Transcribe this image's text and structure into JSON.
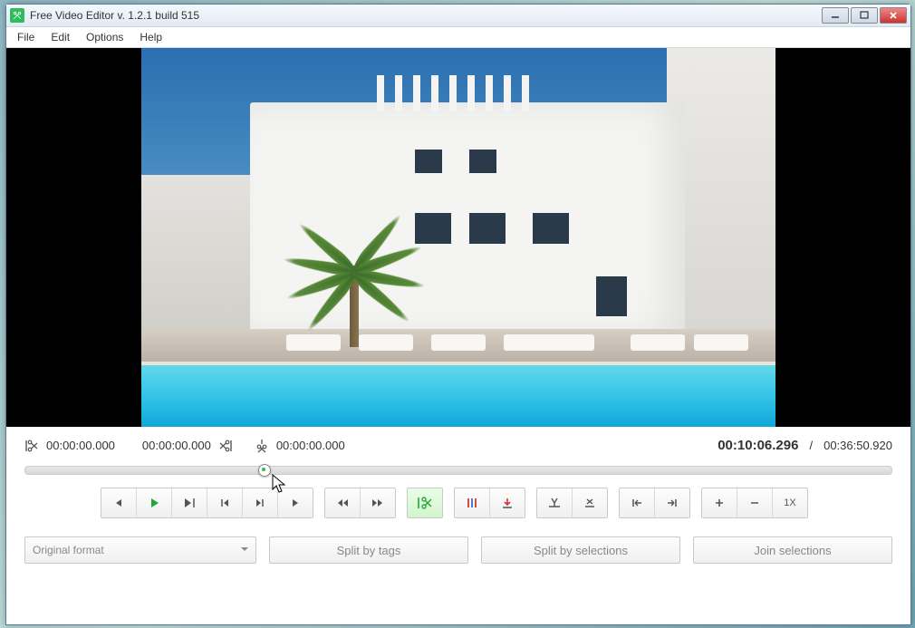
{
  "window": {
    "title": "Free Video Editor v. 1.2.1 build 515"
  },
  "menu": {
    "file": "File",
    "edit": "Edit",
    "options": "Options",
    "help": "Help"
  },
  "timecodes": {
    "sel_start": "00:00:00.000",
    "sel_end": "00:00:00.000",
    "marker": "00:00:00.000",
    "current": "00:10:06.296",
    "sep": "/",
    "total": "00:36:50.920"
  },
  "playback": {
    "progress_percent": 27.5
  },
  "zoom_label": "1X",
  "format": {
    "selected": "Original format"
  },
  "buttons": {
    "split_tags": "Split by tags",
    "split_sel": "Split by selections",
    "join_sel": "Join selections"
  }
}
